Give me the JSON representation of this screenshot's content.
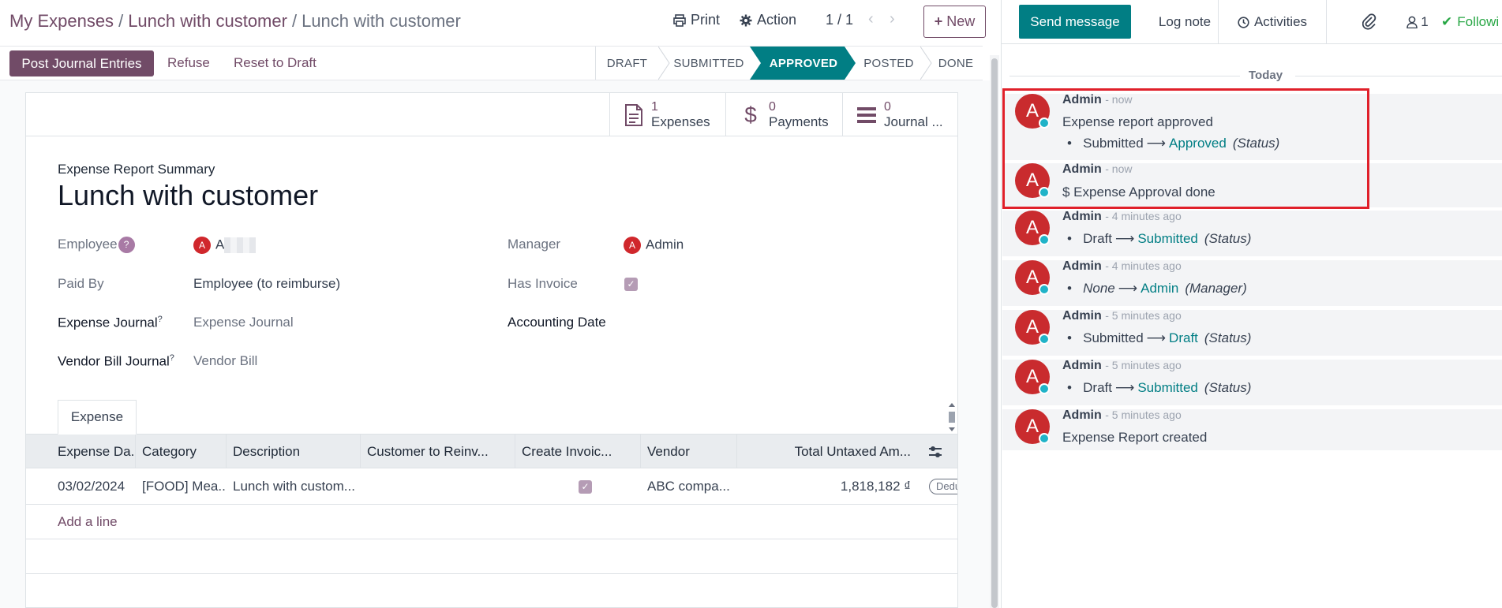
{
  "breadcrumb": {
    "items": [
      "My Expenses",
      "Lunch with customer"
    ],
    "current": "Lunch with customer",
    "separator": "/"
  },
  "top_actions": {
    "print_label": "Print",
    "action_label": "Action",
    "pager": "1 / 1",
    "new_label": "New"
  },
  "statusbar": {
    "buttons": [
      "Post Journal Entries",
      "Refuse",
      "Reset to Draft"
    ],
    "stages": [
      "DRAFT",
      "SUBMITTED",
      "APPROVED",
      "POSTED",
      "DONE"
    ],
    "active_stage": "APPROVED"
  },
  "smart_buttons": [
    {
      "count": "1",
      "label": "Expenses",
      "icon": "file-icon"
    },
    {
      "count": "0",
      "label": "Payments",
      "icon": "dollar-icon"
    },
    {
      "count": "0",
      "label": "Journal ...",
      "icon": "list-icon"
    }
  ],
  "form": {
    "summary_label": "Expense Report Summary",
    "title": "Lunch with customer",
    "employee_label": "Employee",
    "employee_help": "?",
    "employee_avatar": "A",
    "employee_value": "A",
    "paid_by_label": "Paid By",
    "paid_by_value": "Employee (to reimburse)",
    "expense_journal_label": "Expense Journal",
    "expense_journal_sup": "?",
    "expense_journal_value": "Expense Journal",
    "vendor_bill_journal_label": "Vendor Bill Journal",
    "vendor_bill_journal_sup": "?",
    "vendor_bill_journal_value": "Vendor Bill",
    "manager_label": "Manager",
    "manager_avatar": "A",
    "manager_value": "Admin",
    "has_invoice_label": "Has Invoice",
    "has_invoice_checked": true,
    "accounting_date_label": "Accounting Date",
    "accounting_date_value": ""
  },
  "tabs": [
    {
      "label": "Expense"
    }
  ],
  "table": {
    "columns": [
      "Expense Da...",
      "Category",
      "Description",
      "Customer to Reinv...",
      "Create Invoic...",
      "Vendor",
      "Total Untaxed Am..."
    ],
    "rows": [
      {
        "date": "03/02/2024",
        "category": "[FOOD] Mea...",
        "description": "Lunch with custom...",
        "customer": "",
        "create_invoice": true,
        "vendor": "ABC compa...",
        "total": "1,818,182 ₫",
        "tag": "Dedu"
      }
    ],
    "add_line_label": "Add a line"
  },
  "chatter": {
    "send_message_label": "Send message",
    "log_note_label": "Log note",
    "activities_label": "Activities",
    "followers_count": "1",
    "following_label": "Followi",
    "today_label": "Today",
    "messages": [
      {
        "author": "Admin",
        "time": "now",
        "body": "Expense report approved",
        "change": {
          "old": "Submitted",
          "new": "Approved",
          "field": "(Status)"
        }
      },
      {
        "author": "Admin",
        "time": "now",
        "body": "$ Expense Approval done"
      },
      {
        "author": "Admin",
        "time": "4 minutes ago",
        "change": {
          "old": "Draft",
          "new": "Submitted",
          "field": "(Status)"
        }
      },
      {
        "author": "Admin",
        "time": "4 minutes ago",
        "change": {
          "old": "None",
          "new": "Admin",
          "field": "(Manager)"
        }
      },
      {
        "author": "Admin",
        "time": "5 minutes ago",
        "change": {
          "old": "Submitted",
          "new": "Draft",
          "field": "(Status)"
        }
      },
      {
        "author": "Admin",
        "time": "5 minutes ago",
        "change": {
          "old": "Draft",
          "new": "Submitted",
          "field": "(Status)"
        }
      },
      {
        "author": "Admin",
        "time": "5 minutes ago",
        "body": "Expense Report created"
      }
    ],
    "avatar_letter": "A"
  },
  "colors": {
    "brand": "#714B67",
    "teal": "#017e84",
    "highlight_border": "#e0202a",
    "avatar": "#c92b2e"
  }
}
